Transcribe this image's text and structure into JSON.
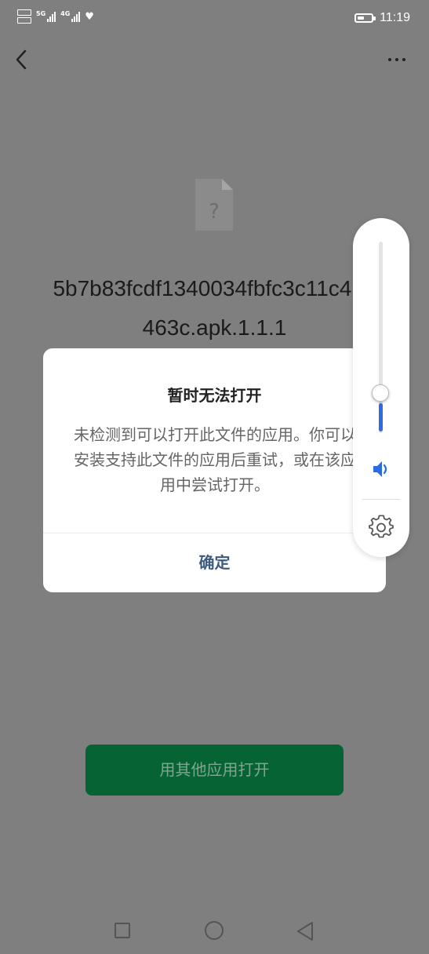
{
  "status_bar": {
    "network_1": "5G",
    "network_2": "4G",
    "time": "11:19"
  },
  "file": {
    "name_line1": "5b7b83fcdf1340034fbfc3c11c419",
    "name_line2": "463c.apk.1.1.1",
    "icon_glyph": "?"
  },
  "dialog": {
    "title": "暂时无法打开",
    "message": "未检测到可以打开此文件的应用。你可以安装支持此文件的应用后重试，或在该应用中尝试打开。",
    "confirm_label": "确定"
  },
  "volume_panel": {
    "level": 0.15,
    "accent_color": "#2d6be4"
  },
  "actions": {
    "open_with_other_label": "用其他应用打开"
  },
  "icons": {
    "back": "back-chevron-icon",
    "more": "more-dots-icon",
    "speaker": "speaker-icon",
    "settings": "gear-icon"
  },
  "colors": {
    "primary_button": "#066434",
    "dialog_confirm": "#3d5a80"
  }
}
